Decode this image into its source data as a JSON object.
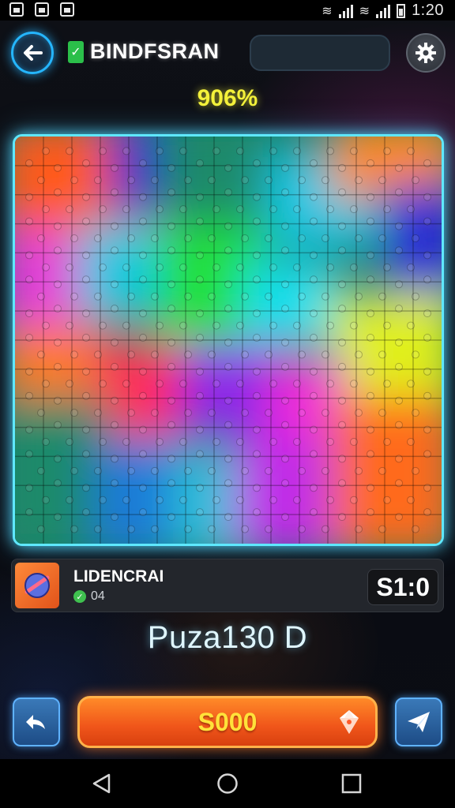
{
  "status_bar": {
    "time": "1:20",
    "icons": [
      "photo-icon",
      "upload-icon",
      "cassette-icon",
      "wifi-icon",
      "signal-icon",
      "wifi-icon",
      "signal-icon",
      "battery-icon"
    ]
  },
  "header": {
    "title": "BINDFSRAN",
    "back_icon": "arrow-left-icon",
    "settings_icon": "gear-icon",
    "search_value": ""
  },
  "progress": {
    "text": "906%"
  },
  "board": {
    "columns": 15,
    "rows": 14,
    "border_color": "#5fe8ff"
  },
  "info_card": {
    "title": "LIDENCRAI",
    "subtitle": "04",
    "score": "S1:0",
    "thumb_icon": "planet-icon"
  },
  "puzzle_name": "Puzа130 D",
  "actions": {
    "left_icon": "share-arrow-icon",
    "main_label": "S000",
    "main_icon": "gem-icon",
    "right_icon": "paper-plane-icon",
    "accent": "#f0551a"
  },
  "nav": {
    "back_icon": "triangle-back-icon",
    "home_icon": "circle-home-icon",
    "recent_icon": "square-recent-icon"
  }
}
